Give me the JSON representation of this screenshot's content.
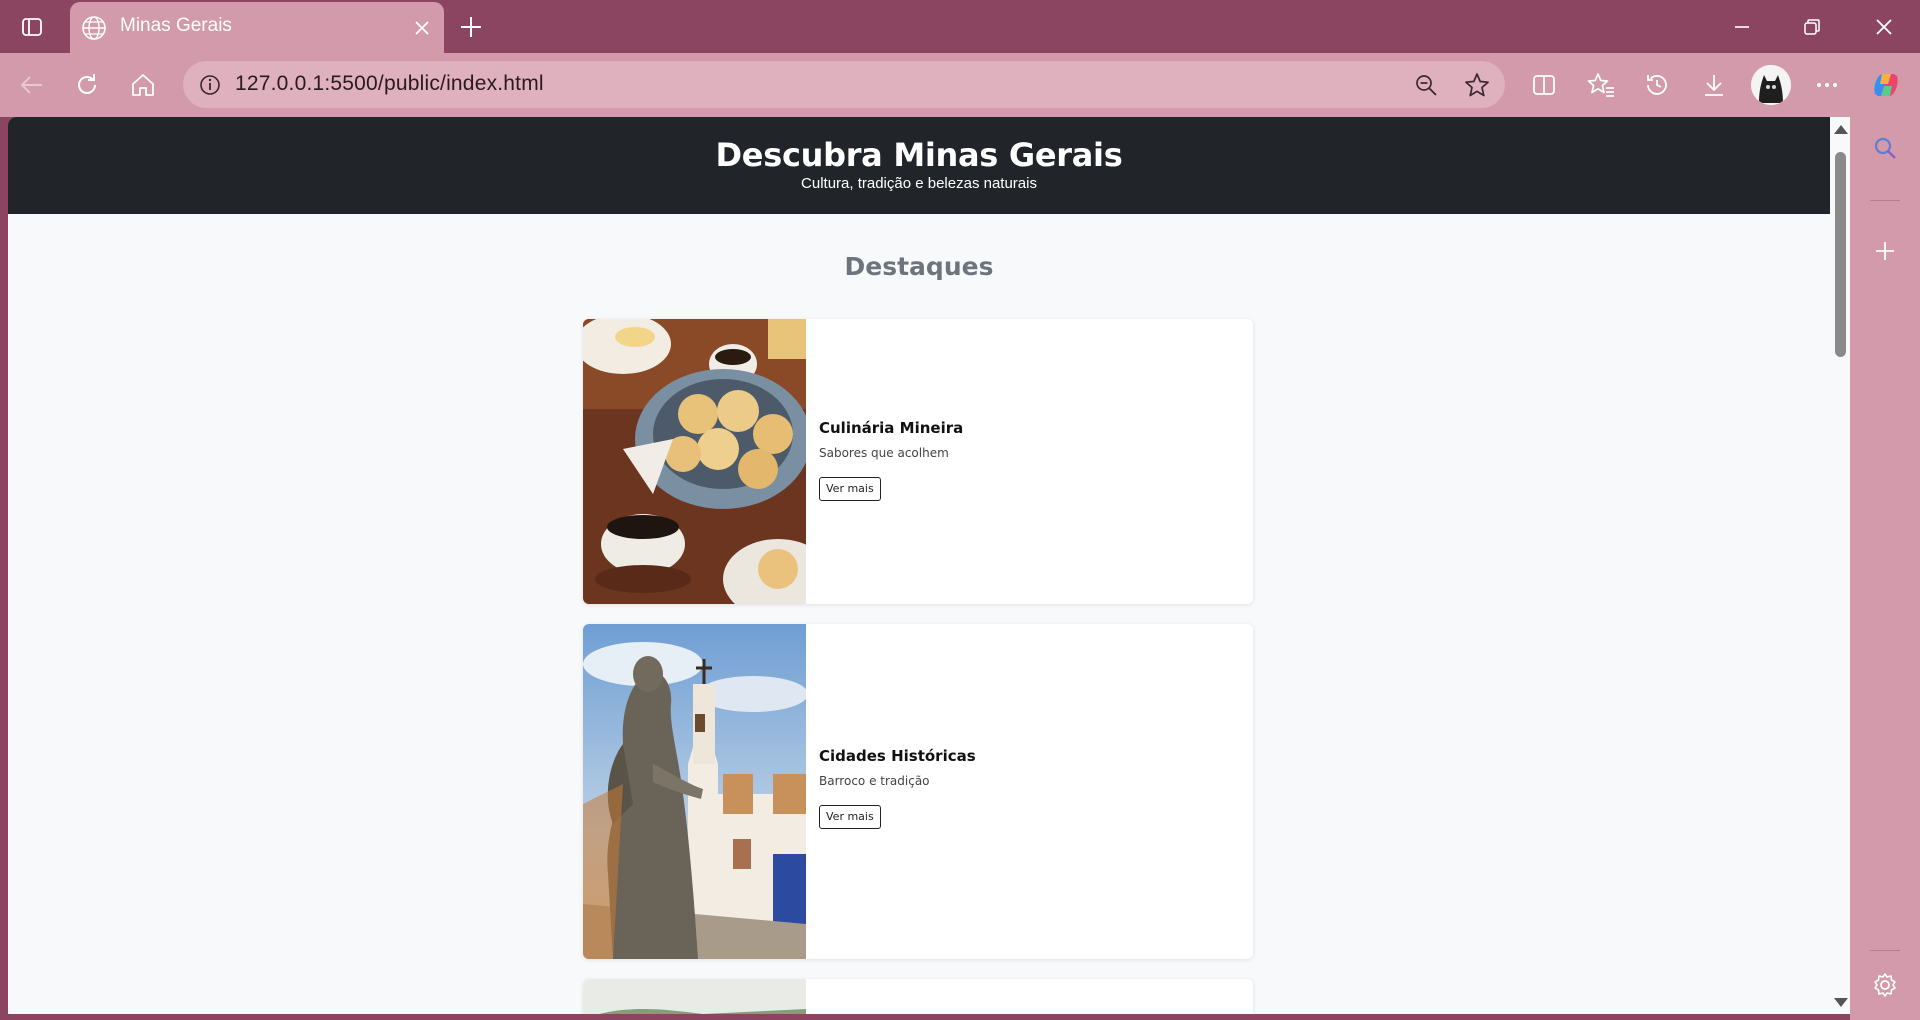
{
  "browser": {
    "tab_title": "Minas Gerais",
    "url": "127.0.0.1:5500/public/index.html"
  },
  "site": {
    "title": "Descubra Minas Gerais",
    "subtitle": "Cultura, tradição e belezas naturais",
    "section_title": "Destaques"
  },
  "cards": [
    {
      "title": "Culinária Mineira",
      "text": "Sabores que acolhem",
      "button": "Ver mais",
      "image": "pao-de-queijo-coffee-photo"
    },
    {
      "title": "Cidades Históricas",
      "text": "Barroco e tradição",
      "button": "Ver mais",
      "image": "baroque-church-statue-photo"
    }
  ],
  "colors": {
    "chrome_dark": "#8c4561",
    "chrome_light": "#d29aaa",
    "header_bg": "#212529",
    "page_bg": "#f8f9fa",
    "section_title": "#6c757d"
  }
}
